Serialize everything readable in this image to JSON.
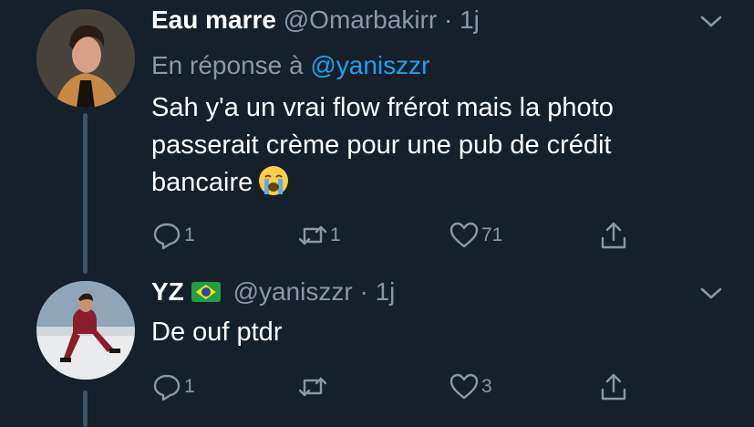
{
  "tweets": [
    {
      "display_name": "Eau marre",
      "handle": "@Omarbakirr",
      "separator": "·",
      "time": "1j",
      "reply_prefix": "En réponse à",
      "reply_mention": "@yaniszzr",
      "text": "Sah y'a un vrai flow frérot mais la photo passerait crème pour une pub de crédit bancaire",
      "emoji": "loudly-crying-face",
      "counts": {
        "replies": "1",
        "retweets": "1",
        "likes": "71"
      }
    },
    {
      "display_name": "YZ",
      "flag": "brazil-flag",
      "handle": "@yaniszzr",
      "separator": "·",
      "time": "1j",
      "text": "De ouf ptdr",
      "counts": {
        "replies": "1",
        "retweets": "",
        "likes": "3"
      }
    }
  ],
  "colors": {
    "background": "#15202b",
    "text_primary": "#ffffff",
    "text_secondary": "#8899a6",
    "link": "#1da1f2",
    "thread_line": "#3d5466"
  }
}
